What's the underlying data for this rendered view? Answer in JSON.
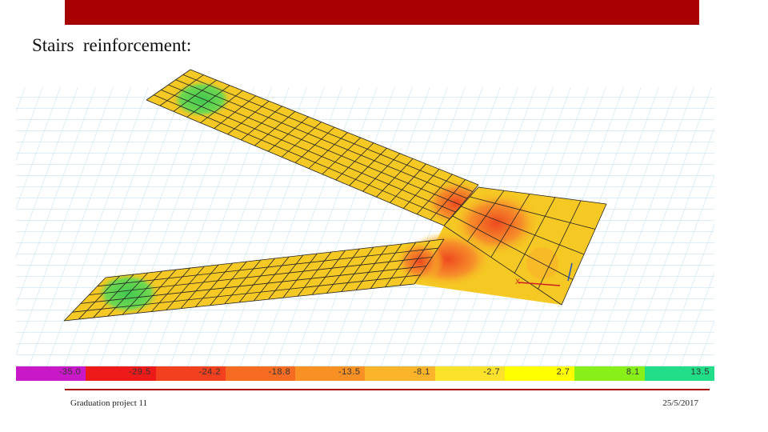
{
  "slide": {
    "title": "Stairs  reinforcement:",
    "footer_left": "Graduation project 11",
    "footer_right": "25/5/2017",
    "accent_color": "#a80000"
  },
  "legend": {
    "segments": [
      {
        "label": "-35.0",
        "color": "#c818c8"
      },
      {
        "label": "-29.5",
        "color": "#ee1a1a"
      },
      {
        "label": "-24.2",
        "color": "#f3411f"
      },
      {
        "label": "-18.8",
        "color": "#f66b22"
      },
      {
        "label": "-13.5",
        "color": "#f99024"
      },
      {
        "label": "-8.1",
        "color": "#fbb42a"
      },
      {
        "label": "-2.7",
        "color": "#fde22c"
      },
      {
        "label": "2.7",
        "color": "#ffff00"
      },
      {
        "label": "8.1",
        "color": "#88f018"
      },
      {
        "label": "13.5",
        "color": "#22dd88"
      }
    ]
  },
  "figure": {
    "description_colors": {
      "slab": "#f5c823",
      "hot": "#ee5020",
      "cool": "#58d058",
      "grid": "#b8dcec"
    },
    "axis_label": "X"
  }
}
